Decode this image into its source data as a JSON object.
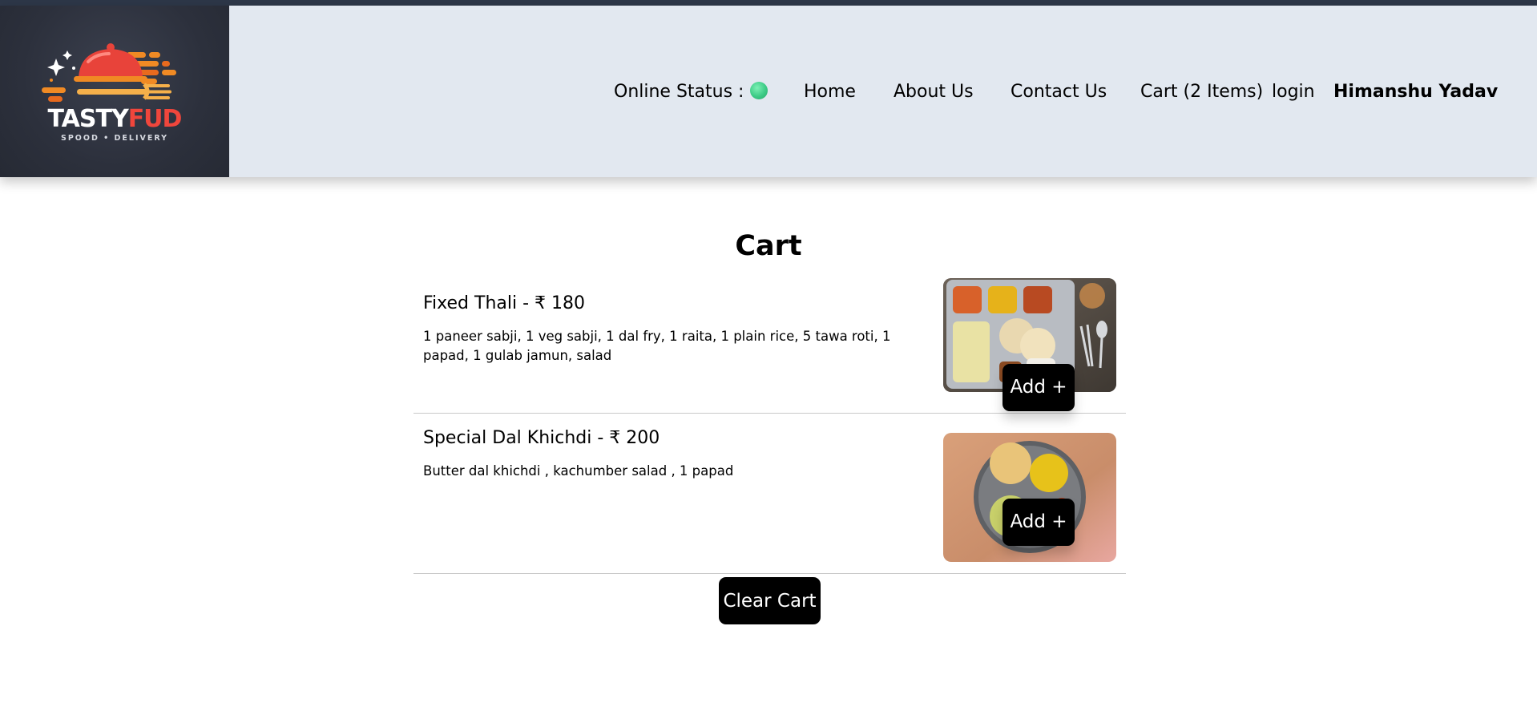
{
  "brand": {
    "name_part1": "TASTY",
    "name_part2": "FUD",
    "tagline": "SPOOD • DELIVERY",
    "colors": {
      "accent": "#f0463c",
      "orange": "#f08a24",
      "dark": "#2c303c"
    }
  },
  "nav": {
    "status_label": "Online Status :",
    "status_online": true,
    "home": "Home",
    "about": "About Us",
    "contact": "Contact Us",
    "cart": "Cart (2 Items)",
    "login": "login",
    "user": "Himanshu Yadav"
  },
  "cart": {
    "title": "Cart",
    "items": [
      {
        "name": "Fixed Thali - ₹ 180",
        "description": "1 paneer sabji, 1 veg sabji, 1 dal fry, 1 raita, 1 plain rice, 5 tawa roti, 1 papad, 1 gulab jamun, salad",
        "add_label": "Add +",
        "image_icon": "thali-plate-image"
      },
      {
        "name": "Special Dal Khichdi - ₹ 200",
        "description": "Butter dal khichdi , kachumber salad , 1 papad",
        "add_label": "Add +",
        "image_icon": "khichdi-plate-image"
      }
    ],
    "clear_label": "Clear Cart"
  }
}
